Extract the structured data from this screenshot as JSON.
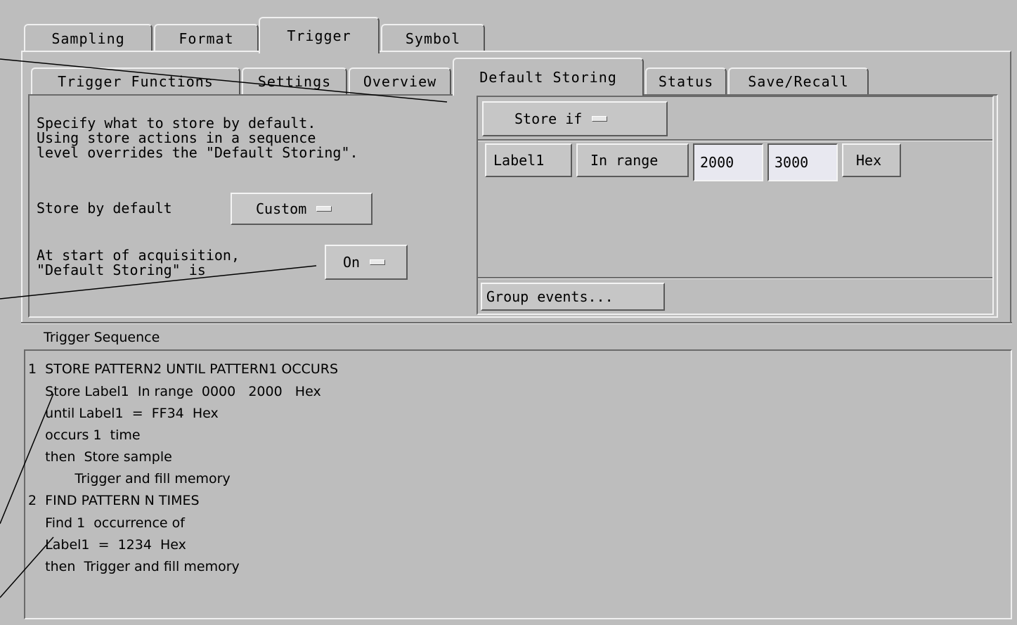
{
  "main_tabs": [
    "Sampling",
    "Format",
    "Trigger",
    "Symbol"
  ],
  "sub_tabs": [
    "Trigger Functions",
    "Settings",
    "Overview",
    "Default Storing",
    "Status",
    "Save/Recall"
  ],
  "description": {
    "line1": "Specify what to store by default.",
    "line2": "Using store actions in a sequence",
    "line3": "level overrides the \"Default Storing\"."
  },
  "store_default": {
    "label": "Store by default",
    "value": "Custom"
  },
  "acquisition": {
    "line1": "At start of acquisition,",
    "line2": "\"Default Storing\" is",
    "value": "On"
  },
  "condition": {
    "store_if": "Store if",
    "label": "Label1",
    "operator": "In range",
    "from": "2000",
    "to": "3000",
    "base": "Hex",
    "group_events": "Group events..."
  },
  "sequence": {
    "title": "Trigger Sequence",
    "lines": [
      "1  STORE PATTERN2 UNTIL PATTERN1 OCCURS",
      "    Store Label1  In range  0000   2000   Hex",
      "    until Label1  =  FF34  Hex",
      "    occurs 1  time",
      "    then  Store sample",
      "           Trigger and fill memory",
      "2  FIND PATTERN N TIMES",
      "    Find 1  occurrence of",
      "    Label1  =  1234  Hex",
      "    then  Trigger and fill memory"
    ]
  }
}
